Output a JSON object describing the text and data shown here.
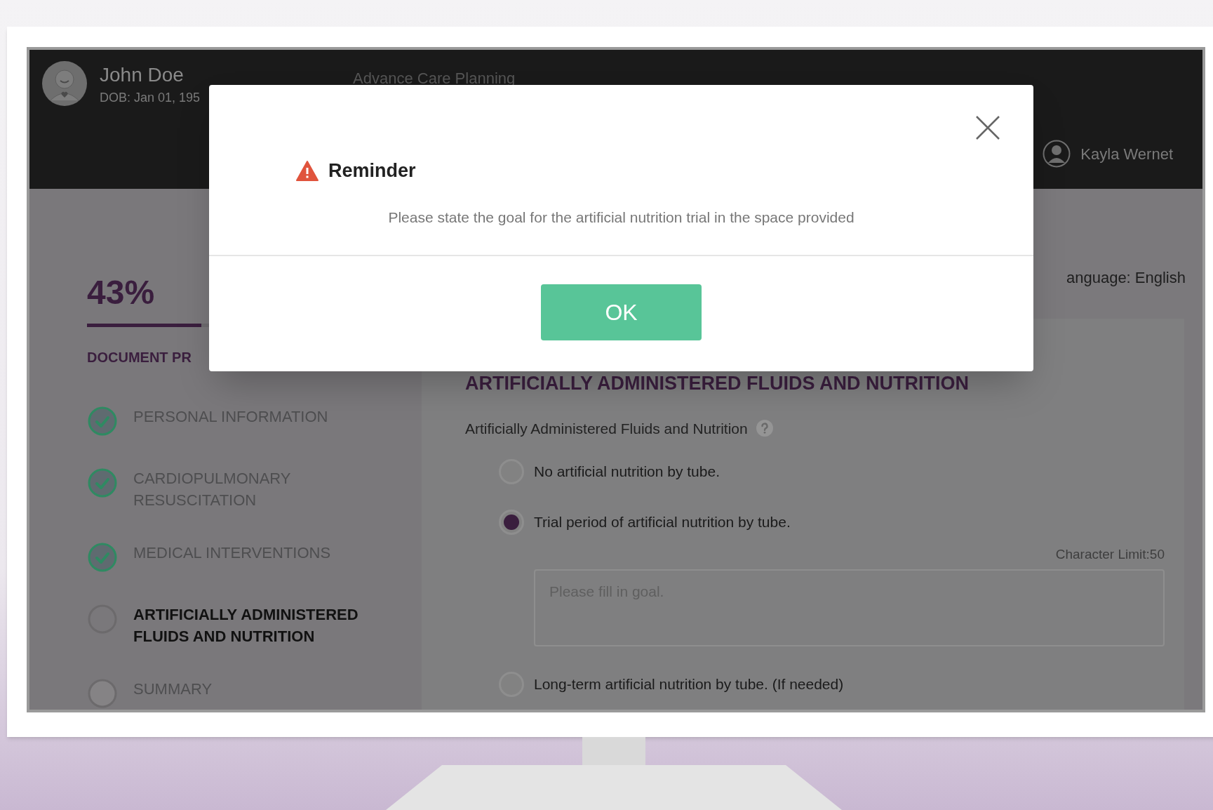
{
  "header": {
    "patient_name": "John Doe",
    "dob": "DOB: Jan 01, 195",
    "title": "Advance Care Planning",
    "user_name": "Kayla Wernet"
  },
  "progress": {
    "percent": "43%",
    "level": 0.43,
    "label": "DOCUMENT PR"
  },
  "steps": [
    {
      "label": "PERSONAL INFORMATION",
      "done": true,
      "selected": false
    },
    {
      "label": "CARDIOPULMONARY RESUSCITATION",
      "done": true,
      "selected": false
    },
    {
      "label": "MEDICAL INTERVENTIONS",
      "done": true,
      "selected": false
    },
    {
      "label": "ARTIFICIALLY ADMINISTERED FLUIDS AND NUTRITION",
      "done": false,
      "selected": true
    },
    {
      "label": "SUMMARY",
      "done": false,
      "selected": false
    }
  ],
  "language": "anguage: English",
  "section": {
    "heading": "ARTIFICIALLY ADMINISTERED FLUIDS AND NUTRITION",
    "question": "Artificially Administered Fluids and Nutrition",
    "options": [
      {
        "label": "No artificial nutrition by tube.",
        "selected": false
      },
      {
        "label": "Trial period of artificial nutrition by tube.",
        "selected": true,
        "character_limit": "Character Limit:50",
        "placeholder": "Please fill in goal."
      },
      {
        "label": "Long-term artificial nutrition by tube. (If needed)",
        "selected": false
      }
    ]
  },
  "dialog": {
    "title": "Reminder",
    "message": "Please state the goal for the artificial nutrition trial in the space provided",
    "button": "OK"
  }
}
